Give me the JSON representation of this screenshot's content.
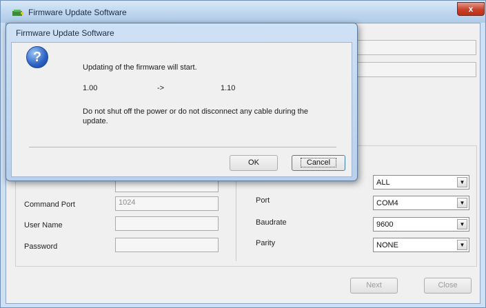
{
  "main_window": {
    "title": "Firmware Update Software",
    "close_label": "x"
  },
  "settings": {
    "command_port_label": "Command Port",
    "command_port_value": "1024",
    "user_name_label": "User Name",
    "password_label": "Password",
    "port_label": "Port",
    "baudrate_label": "Baudrate",
    "parity_label": "Parity",
    "selects": {
      "first_value": "ALL",
      "port_value": "COM4",
      "baudrate_value": "9600",
      "parity_value": "NONE"
    }
  },
  "buttons": {
    "next_label": "Next",
    "close_label": "Close"
  },
  "dialog": {
    "title": "Firmware Update Software",
    "icon": "question-icon",
    "line1": "Updating of the firmware will start.",
    "version_from": "1.00",
    "arrow": "->",
    "version_to": "1.10",
    "warning_line1": "Do not shut off the power or do not disconnect any cable during the",
    "warning_line2": "update.",
    "ok_label": "OK",
    "cancel_label": "Cancel"
  },
  "colors": {
    "titlebar": "#bcd4ee",
    "close_button": "#c8402a",
    "question_icon": "#2a62c4"
  }
}
